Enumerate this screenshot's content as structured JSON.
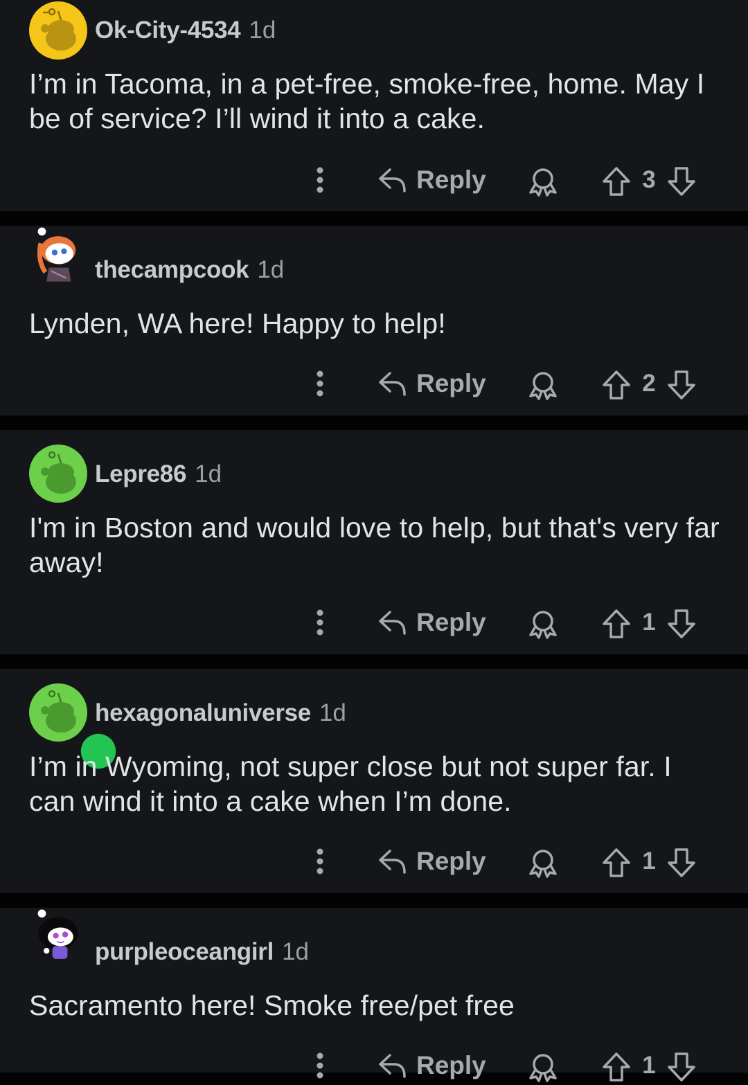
{
  "colors": {
    "background": "#030303",
    "card": "#141619",
    "text": "#e2e4e6",
    "muted": "#9aa0a4",
    "action": "#a5aaae",
    "avatar_yellow": "#f5c518",
    "avatar_green": "#6cd04a",
    "online_dot": "#23c552"
  },
  "actions": {
    "more_icon": "vertical-dots-icon",
    "reply_icon": "reply-arrow-icon",
    "reply_label": "Reply",
    "award_icon": "award-icon",
    "upvote_icon": "upvote-arrow-icon",
    "downvote_icon": "downvote-arrow-icon"
  },
  "comments": [
    {
      "username": "Ok-City-4534",
      "time": "1d",
      "avatar": "yellow-snoo-avatar",
      "text": "I’m in Tacoma, in a pet-free, smoke-free, home. May I be of service? I’ll wind it into a cake.",
      "score": "3"
    },
    {
      "username": "thecampcook",
      "time": "1d",
      "avatar": "custom-redhead-snoo-avatar",
      "text": "Lynden, WA here! Happy to help!",
      "score": "2"
    },
    {
      "username": "Lepre86",
      "time": "1d",
      "avatar": "green-snoo-avatar",
      "text": "I'm in Boston and would love to help, but that's very far away!",
      "score": "1"
    },
    {
      "username": "hexagonaluniverse",
      "time": "1d",
      "avatar": "green-snoo-avatar-online",
      "text": "I’m in Wyoming, not super close but not super far. I can wind it into a cake when I’m done.",
      "score": "1"
    },
    {
      "username": "purpleoceangirl",
      "time": "1d",
      "avatar": "custom-purple-snoo-avatar",
      "text": "Sacramento here! Smoke free/pet free",
      "score": "1"
    }
  ]
}
